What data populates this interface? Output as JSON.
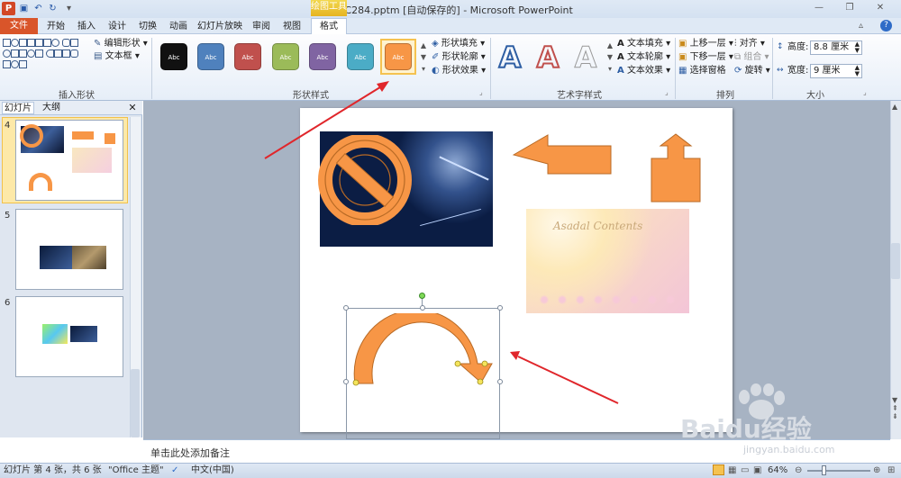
{
  "title_bar": {
    "title": "pptC284.pptm [自动保存的] - Microsoft PowerPoint",
    "context_tab": "绘图工具"
  },
  "tabs": [
    "文件",
    "开始",
    "插入",
    "设计",
    "切换",
    "动画",
    "幻灯片放映",
    "审阅",
    "视图",
    "格式"
  ],
  "ribbon": {
    "insert_shapes": {
      "edit_shape": "编辑形状",
      "text_box": "文本框",
      "label": "插入形状"
    },
    "shape_styles": {
      "label": "形状样式",
      "preset_text": "Abc",
      "presets": [
        "#111111",
        "#4f81bd",
        "#c0504d",
        "#9bbb59",
        "#8064a2",
        "#4bacc6",
        "#f79646"
      ],
      "fill": "形状填充",
      "outline": "形状轮廓",
      "effects": "形状效果"
    },
    "wordart": {
      "label": "艺术字样式",
      "text_fill": "文本填充",
      "text_outline": "文本轮廓",
      "text_effects": "文本效果"
    },
    "arrange": {
      "label": "排列",
      "bring_forward": "上移一层",
      "send_backward": "下移一层",
      "selection_pane": "选择窗格",
      "align": "对齐",
      "group": "组合",
      "rotate": "旋转"
    },
    "size": {
      "label": "大小",
      "height_label": "高度:",
      "height_value": "8.8 厘米",
      "width_label": "宽度:",
      "width_value": "9 厘米"
    }
  },
  "left_panel": {
    "tab_slides": "幻灯片",
    "tab_outline": "大纲",
    "close": "✕",
    "slide_numbers": [
      "4",
      "5",
      "6"
    ]
  },
  "slide": {
    "image_text": "Asadal Contents"
  },
  "notes_placeholder": "单击此处添加备注",
  "status": {
    "slide_info": "幻灯片 第 4 张，共 6 张",
    "theme": "\"Office 主题\"",
    "language": "中文(中国)",
    "zoom": "64%"
  },
  "watermark": {
    "brand": "Baidu经验",
    "url": "jingyan.baidu.com"
  },
  "colors": {
    "accent_orange": "#f79646",
    "arrow_red": "#e0262b",
    "file_tab": "#d9552a"
  }
}
